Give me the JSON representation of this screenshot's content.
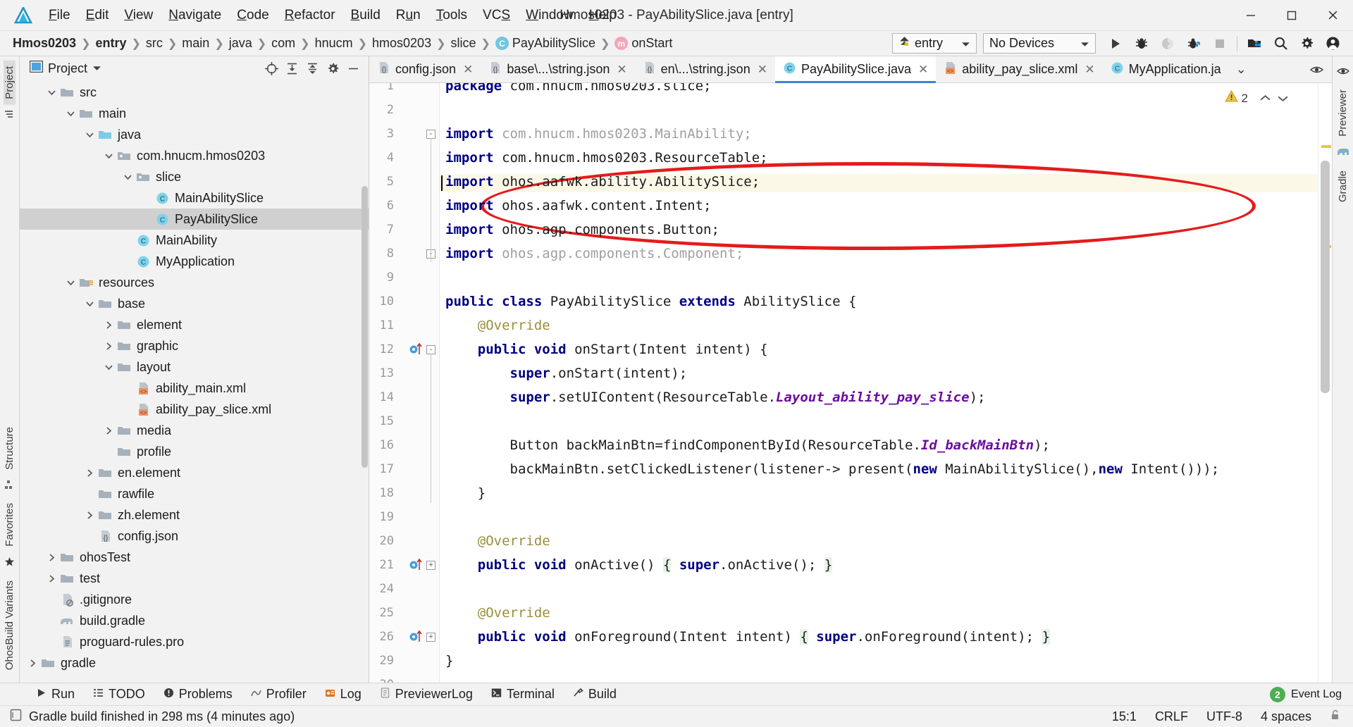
{
  "window": {
    "title": "Hmos0203 - PayAbilitySlice.java [entry]",
    "minimize_label": "Minimize",
    "maximize_label": "Maximize",
    "close_label": "Close"
  },
  "menu": [
    {
      "label": "File",
      "mnemonic": "F"
    },
    {
      "label": "Edit",
      "mnemonic": "E"
    },
    {
      "label": "View",
      "mnemonic": "V"
    },
    {
      "label": "Navigate",
      "mnemonic": "N"
    },
    {
      "label": "Code",
      "mnemonic": "C"
    },
    {
      "label": "Refactor",
      "mnemonic": "R"
    },
    {
      "label": "Build",
      "mnemonic": "B"
    },
    {
      "label": "Run",
      "mnemonic": "u"
    },
    {
      "label": "Tools",
      "mnemonic": "T"
    },
    {
      "label": "VCS",
      "mnemonic": "S"
    },
    {
      "label": "Window",
      "mnemonic": "W"
    },
    {
      "label": "Help",
      "mnemonic": "H"
    }
  ],
  "breadcrumbs": [
    {
      "label": "Hmos0203",
      "bold": true,
      "icon": ""
    },
    {
      "label": "entry",
      "bold": true,
      "icon": ""
    },
    {
      "label": "src",
      "bold": false,
      "icon": ""
    },
    {
      "label": "main",
      "bold": false,
      "icon": ""
    },
    {
      "label": "java",
      "bold": false,
      "icon": ""
    },
    {
      "label": "com",
      "bold": false,
      "icon": ""
    },
    {
      "label": "hnucm",
      "bold": false,
      "icon": ""
    },
    {
      "label": "hmos0203",
      "bold": false,
      "icon": ""
    },
    {
      "label": "slice",
      "bold": false,
      "icon": ""
    },
    {
      "label": "PayAbilitySlice",
      "bold": false,
      "icon": "class-icon",
      "badge": "C"
    },
    {
      "label": "onStart",
      "bold": false,
      "icon": "method-icon",
      "badge": "m"
    }
  ],
  "toolbar": {
    "run_config": "entry",
    "device": "No Devices",
    "buttons": [
      {
        "name": "run-button",
        "icon": "play-icon"
      },
      {
        "name": "debug-button",
        "icon": "bug-icon"
      },
      {
        "name": "run-coverage-button",
        "icon": "coverage-icon"
      },
      {
        "name": "profile-button",
        "icon": "profiler-icon"
      },
      {
        "name": "stop-button",
        "icon": "stop-icon"
      },
      {
        "name": "device-manager-button",
        "icon": "device-manager-icon"
      },
      {
        "name": "search-everywhere-button",
        "icon": "search-icon"
      },
      {
        "name": "settings-button",
        "icon": "gear-icon"
      },
      {
        "name": "account-button",
        "icon": "account-icon"
      }
    ]
  },
  "left_rail": {
    "top": [
      "Project"
    ],
    "bottom": [
      "Structure",
      "Favorites",
      "OhosBuild Variants"
    ]
  },
  "right_rail": {
    "items": [
      "Previewer",
      "Gradle"
    ]
  },
  "project_panel": {
    "title": "Project",
    "header_buttons": [
      {
        "name": "select-opened-file-button",
        "icon": "target-icon"
      },
      {
        "name": "expand-all-button",
        "icon": "expand-all-icon"
      },
      {
        "name": "collapse-all-button",
        "icon": "collapse-all-icon"
      },
      {
        "name": "panel-settings-button",
        "icon": "gear-icon"
      },
      {
        "name": "hide-panel-button",
        "icon": "minimize-icon"
      }
    ],
    "tree": [
      {
        "label": "src",
        "indent": 2,
        "arrow": "down",
        "icon": "folder",
        "selected": false
      },
      {
        "label": "main",
        "indent": 3,
        "arrow": "down",
        "icon": "folder",
        "selected": false
      },
      {
        "label": "java",
        "indent": 4,
        "arrow": "down",
        "icon": "folder-source",
        "selected": false
      },
      {
        "label": "com.hnucm.hmos0203",
        "indent": 5,
        "arrow": "down",
        "icon": "package",
        "selected": false
      },
      {
        "label": "slice",
        "indent": 6,
        "arrow": "down",
        "icon": "package",
        "selected": false
      },
      {
        "label": "MainAbilitySlice",
        "indent": 7,
        "arrow": "none",
        "icon": "class",
        "selected": false
      },
      {
        "label": "PayAbilitySlice",
        "indent": 7,
        "arrow": "none",
        "icon": "class",
        "selected": true
      },
      {
        "label": "MainAbility",
        "indent": 6,
        "arrow": "none",
        "icon": "class",
        "selected": false
      },
      {
        "label": "MyApplication",
        "indent": 6,
        "arrow": "none",
        "icon": "class",
        "selected": false
      },
      {
        "label": "resources",
        "indent": 3,
        "arrow": "down",
        "icon": "folder-res",
        "selected": false
      },
      {
        "label": "base",
        "indent": 4,
        "arrow": "down",
        "icon": "folder",
        "selected": false
      },
      {
        "label": "element",
        "indent": 5,
        "arrow": "right",
        "icon": "folder",
        "selected": false
      },
      {
        "label": "graphic",
        "indent": 5,
        "arrow": "right",
        "icon": "folder",
        "selected": false
      },
      {
        "label": "layout",
        "indent": 5,
        "arrow": "down",
        "icon": "folder",
        "selected": false
      },
      {
        "label": "ability_main.xml",
        "indent": 6,
        "arrow": "none",
        "icon": "xml",
        "selected": false
      },
      {
        "label": "ability_pay_slice.xml",
        "indent": 6,
        "arrow": "none",
        "icon": "xml",
        "selected": false
      },
      {
        "label": "media",
        "indent": 5,
        "arrow": "right",
        "icon": "folder",
        "selected": false
      },
      {
        "label": "profile",
        "indent": 5,
        "arrow": "none",
        "icon": "folder",
        "selected": false
      },
      {
        "label": "en.element",
        "indent": 4,
        "arrow": "right",
        "icon": "folder",
        "selected": false
      },
      {
        "label": "rawfile",
        "indent": 4,
        "arrow": "none",
        "icon": "folder",
        "selected": false
      },
      {
        "label": "zh.element",
        "indent": 4,
        "arrow": "right",
        "icon": "folder",
        "selected": false
      },
      {
        "label": "config.json",
        "indent": 4,
        "arrow": "none",
        "icon": "json",
        "selected": false
      },
      {
        "label": "ohosTest",
        "indent": 2,
        "arrow": "right",
        "icon": "folder",
        "selected": false
      },
      {
        "label": "test",
        "indent": 2,
        "arrow": "right",
        "icon": "folder",
        "selected": false
      },
      {
        "label": ".gitignore",
        "indent": 2,
        "arrow": "none",
        "icon": "gitignore",
        "selected": false
      },
      {
        "label": "build.gradle",
        "indent": 2,
        "arrow": "none",
        "icon": "gradle",
        "selected": false
      },
      {
        "label": "proguard-rules.pro",
        "indent": 2,
        "arrow": "none",
        "icon": "file",
        "selected": false
      },
      {
        "label": "gradle",
        "indent": 1,
        "arrow": "right",
        "icon": "folder",
        "selected": false
      }
    ]
  },
  "editor_tabs": [
    {
      "label": "config.json",
      "icon": "json-icon",
      "active": false
    },
    {
      "label": "base\\...\\string.json",
      "icon": "json-icon",
      "active": false
    },
    {
      "label": "en\\...\\string.json",
      "icon": "json-icon",
      "active": false
    },
    {
      "label": "PayAbilitySlice.java",
      "icon": "class-icon",
      "active": true
    },
    {
      "label": "ability_pay_slice.xml",
      "icon": "xml-icon",
      "active": false
    },
    {
      "label": "MyApplication.ja",
      "icon": "class-icon",
      "active": false
    }
  ],
  "editor": {
    "warning_count": "2",
    "lines": [
      {
        "num": "1",
        "text": "package com.hnucm.hmos0203.slice;",
        "partial": true
      },
      {
        "num": "2",
        "text": ""
      },
      {
        "num": "3",
        "text": "import com.hnucm.hmos0203.MainAbility;"
      },
      {
        "num": "4",
        "text": "import com.hnucm.hmos0203.ResourceTable;"
      },
      {
        "num": "5",
        "text": "import ohos.aafwk.ability.AbilitySlice;"
      },
      {
        "num": "6",
        "text": "import ohos.aafwk.content.Intent;"
      },
      {
        "num": "7",
        "text": "import ohos.agp.components.Button;"
      },
      {
        "num": "8",
        "text": "import ohos.agp.components.Component;"
      },
      {
        "num": "9",
        "text": ""
      },
      {
        "num": "10",
        "text": "public class PayAbilitySlice extends AbilitySlice {"
      },
      {
        "num": "11",
        "text": "    @Override"
      },
      {
        "num": "12",
        "text": "    public void onStart(Intent intent) {"
      },
      {
        "num": "13",
        "text": "        super.onStart(intent);"
      },
      {
        "num": "14",
        "text": "        super.setUIContent(ResourceTable.Layout_ability_pay_slice);"
      },
      {
        "num": "15",
        "text": ""
      },
      {
        "num": "16",
        "text": "        Button backMainBtn=findComponentById(ResourceTable.Id_backMainBtn);"
      },
      {
        "num": "17",
        "text": "        backMainBtn.setClickedListener(listener-> present(new MainAbilitySlice(),new Intent()));"
      },
      {
        "num": "18",
        "text": "    }"
      },
      {
        "num": "19",
        "text": ""
      },
      {
        "num": "20",
        "text": "    @Override"
      },
      {
        "num": "21",
        "text": "    public void onActive() { super.onActive(); }"
      },
      {
        "num": "24",
        "text": ""
      },
      {
        "num": "25",
        "text": "    @Override"
      },
      {
        "num": "26",
        "text": "    public void onForeground(Intent intent) { super.onForeground(intent); }"
      },
      {
        "num": "29",
        "text": "}"
      },
      {
        "num": "30",
        "text": ""
      }
    ],
    "annotation": {
      "shape": "ellipse",
      "color": "#e51b1b",
      "covers_lines": "16-17"
    }
  },
  "tool_windows": [
    {
      "label": "Run",
      "icon": "play-icon"
    },
    {
      "label": "TODO",
      "icon": "todo-icon"
    },
    {
      "label": "Problems",
      "icon": "problems-icon"
    },
    {
      "label": "Profiler",
      "icon": "profiler-icon"
    },
    {
      "label": "Log",
      "icon": "log-icon"
    },
    {
      "label": "PreviewerLog",
      "icon": "previewer-log-icon"
    },
    {
      "label": "Terminal",
      "icon": "terminal-icon"
    },
    {
      "label": "Build",
      "icon": "build-icon"
    }
  ],
  "event_log": {
    "label": "Event Log",
    "count": "2"
  },
  "status_bar": {
    "message": "Gradle build finished in 298 ms (4 minutes ago)",
    "caret_position": "15:1",
    "line_separator": "CRLF",
    "encoding": "UTF-8",
    "indent": "4 spaces",
    "lock_icon": "unlocked-icon"
  },
  "colors": {
    "accent": "#3d82d6",
    "keyword": "#000080",
    "annotation": "#9b8e3c",
    "field": "#6c0e9e",
    "marker_red": "#e51b1b",
    "warning_yellow": "#d4a017"
  }
}
